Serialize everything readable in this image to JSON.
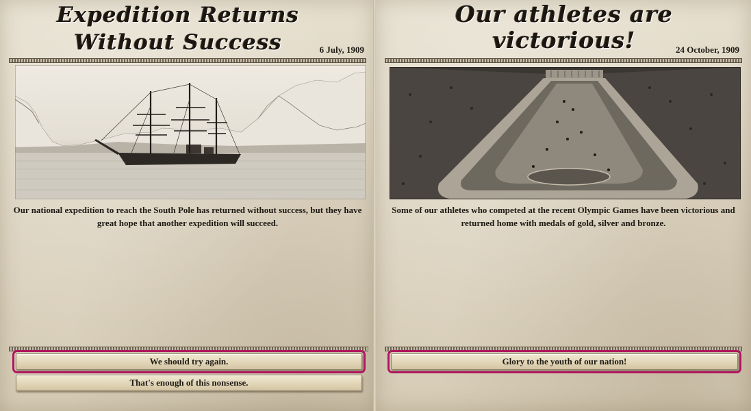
{
  "left_event": {
    "headline": "Expedition Returns Without Success",
    "date": "6 July, 1909",
    "body": "Our national expedition to reach the South Pole has returned without success, but they have great hope that another expedition will succeed.",
    "options": [
      {
        "label": "We should try again.",
        "highlighted": true
      },
      {
        "label": "That's enough of this nonsense.",
        "highlighted": false
      }
    ]
  },
  "right_event": {
    "headline": "Our athletes are victorious!",
    "date": "24 October, 1909",
    "body": "Some of our athletes who competed at the recent Olympic Games have been victorious and returned home with medals of gold, silver and bronze.",
    "options": [
      {
        "label": "Glory to the youth of our nation!",
        "highlighted": true
      }
    ]
  },
  "colors": {
    "highlight": "#b0165f",
    "paper": "#ddd4c1",
    "ink": "#1e1a14"
  }
}
